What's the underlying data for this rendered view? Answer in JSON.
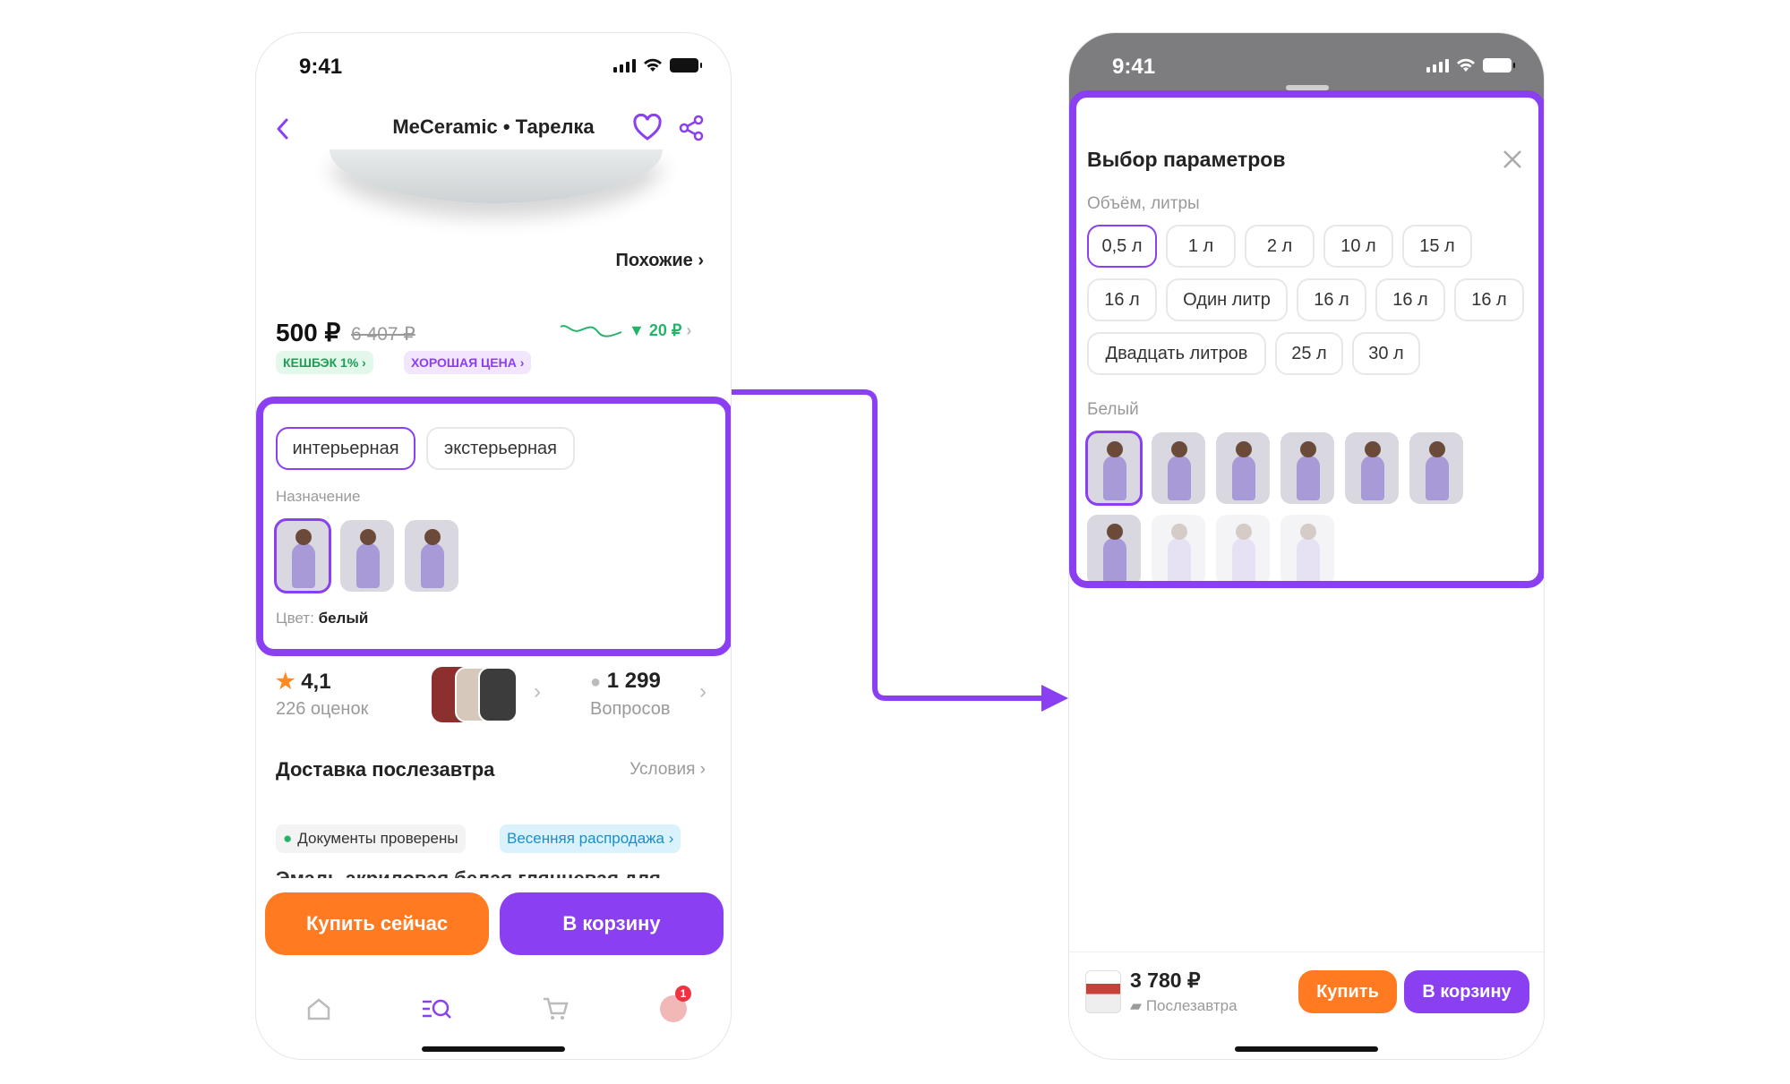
{
  "left": {
    "status_time": "9:41",
    "title": "MeCeramic • Тарелка",
    "similar_link": "Похожие",
    "price": "500 ₽",
    "old_price": "6 407 ₽",
    "price_drop": "20 ₽",
    "cashback_tag": "КЕШБЭК 1%",
    "good_price_tag": "ХОРОШАЯ ЦЕНА",
    "options": [
      "интерьерная",
      "экстерьерная"
    ],
    "purpose_label": "Назначение",
    "color_label": "Цвет:",
    "color_value": "белый",
    "rating": "4,1",
    "ratings_count": "226 оценок",
    "questions_count": "1 299",
    "questions_label": "Вопросов",
    "delivery": "Доставка послезавтра",
    "delivery_terms": "Условия",
    "docs_badge": "Документы проверены",
    "sale_badge": "Весенняя распродажа",
    "desc_cut": "Эмаль акриловая белая глянцевая для",
    "buy_now": "Купить сейчас",
    "to_cart": "В корзину",
    "profile_badge": "1"
  },
  "right": {
    "status_time": "9:41",
    "title": "Выбор параметров",
    "volume_label": "Объём, литры",
    "volumes_row1": [
      "0,5 л",
      "1 л",
      "2 л",
      "10 л",
      "15 л"
    ],
    "volumes_row2": [
      "16 л",
      "Один литр",
      "16 л",
      "16 л",
      "16 л"
    ],
    "volumes_row3": [
      "Двадцать литров",
      "25 л",
      "30 л"
    ],
    "color_label": "Белый",
    "price": "3 780 ₽",
    "delivery": "Послезавтра",
    "buy": "Купить",
    "to_cart": "В корзину"
  },
  "colors": {
    "accent": "#8a3ff0",
    "orange": "#ff7a20",
    "green": "#25b36a"
  }
}
